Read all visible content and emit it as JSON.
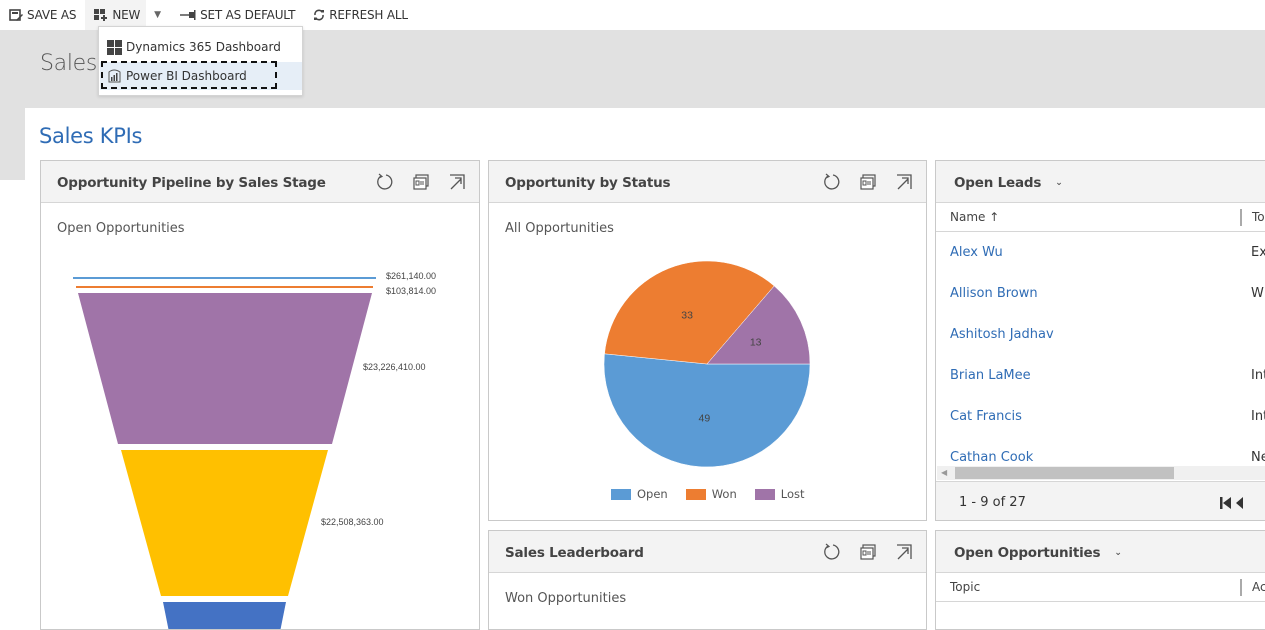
{
  "toolbar": {
    "save_as": "SAVE AS",
    "new": "NEW",
    "set_default": "SET AS DEFAULT",
    "refresh_all": "REFRESH ALL"
  },
  "new_menu": {
    "items": [
      {
        "label": "Dynamics 365 Dashboard",
        "icon": "tiles-icon"
      },
      {
        "label": "Power BI Dashboard",
        "icon": "powerbi-icon",
        "focused": true
      }
    ]
  },
  "header": {
    "dashboard_name": "Sales"
  },
  "dashboard": {
    "title": "Sales KPIs"
  },
  "cards": {
    "pipeline": {
      "title": "Opportunity Pipeline by Sales Stage",
      "subtitle": "Open Opportunities",
      "icons": [
        "refresh-icon",
        "view-records-icon",
        "expand-icon"
      ]
    },
    "status": {
      "title": "Opportunity by Status",
      "subtitle": "All Opportunities",
      "icons": [
        "refresh-icon",
        "view-records-icon",
        "expand-icon"
      ]
    },
    "leaderboard": {
      "title": "Sales Leaderboard",
      "subtitle": "Won Opportunities",
      "icons": [
        "refresh-icon",
        "view-records-icon",
        "expand-icon"
      ]
    },
    "open_leads": {
      "view_title": "Open Leads",
      "columns": {
        "name": "Name ↑",
        "topic": "To"
      },
      "rows": [
        {
          "name": "Alex Wu",
          "topic": "Ex"
        },
        {
          "name": "Allison Brown",
          "topic": "W"
        },
        {
          "name": "Ashitosh Jadhav",
          "topic": ""
        },
        {
          "name": "Brian LaMee",
          "topic": "Int"
        },
        {
          "name": "Cat Francis",
          "topic": "Int"
        },
        {
          "name": "Cathan Cook",
          "topic": "Ne"
        }
      ],
      "paging": "1 - 9 of 27"
    },
    "open_opportunities": {
      "view_title": "Open Opportunities",
      "columns": {
        "topic": "Topic",
        "second": "Ac"
      }
    }
  },
  "chart_data": [
    {
      "type": "funnel",
      "title": "Opportunity Pipeline by Sales Stage",
      "subtitle": "Open Opportunities",
      "stages": [
        {
          "label": "$261,140.00",
          "value": 261140.0,
          "color": "#5b9bd5"
        },
        {
          "label": "$103,814.00",
          "value": 103814.0,
          "color": "#ed7d31"
        },
        {
          "label": "$23,226,410.00",
          "value": 23226410.0,
          "color": "#a074a8"
        },
        {
          "label": "$22,508,363.00",
          "value": 22508363.0,
          "color": "#ffc000"
        },
        {
          "label": "",
          "value": null,
          "color": "#4472c4"
        }
      ]
    },
    {
      "type": "pie",
      "title": "Opportunity by Status",
      "subtitle": "All Opportunities",
      "categories": [
        "Open",
        "Won",
        "Lost"
      ],
      "values": [
        49,
        33,
        13
      ],
      "colors": [
        "#5b9bd5",
        "#ed7d31",
        "#a074a8"
      ],
      "legend": "bottom"
    }
  ]
}
